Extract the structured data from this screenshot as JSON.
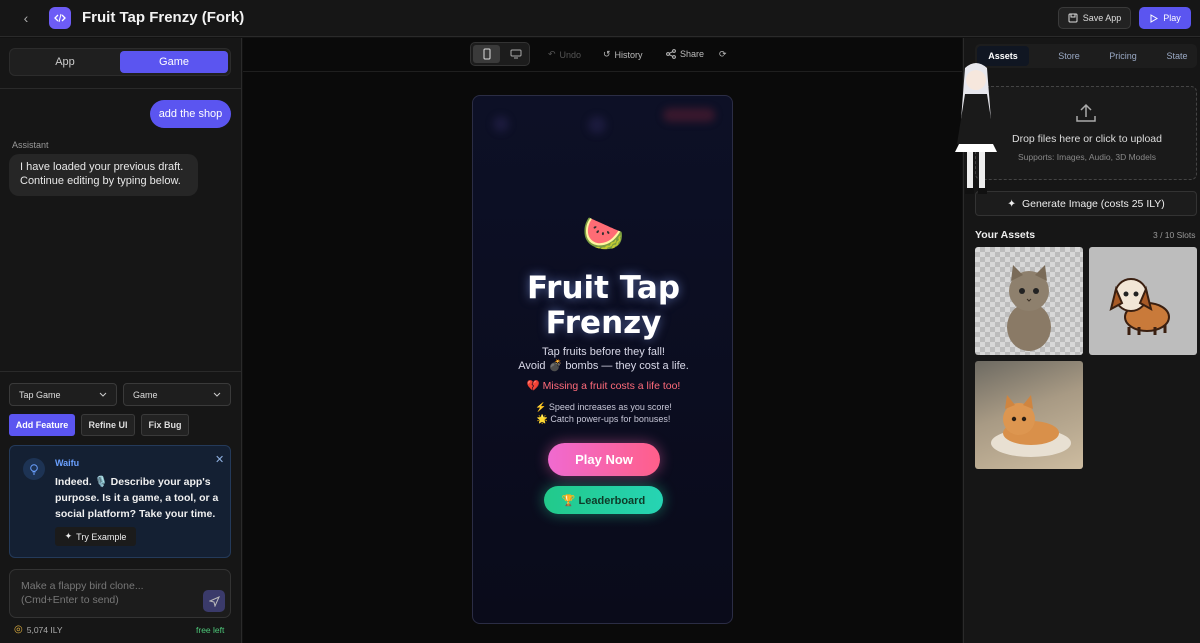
{
  "header": {
    "title": "Fruit Tap Frenzy (Fork)",
    "save_label": "Save App",
    "play_label": "Play"
  },
  "left_panel": {
    "segments": {
      "app": "App",
      "game": "Game"
    },
    "chat": {
      "user_message": "add the shop",
      "assistant_label": "Assistant",
      "assistant_line1": "I have loaded your previous draft.",
      "assistant_line2": "Continue editing by typing below."
    },
    "selects": {
      "template": "Tap Game",
      "mode": "Game"
    },
    "chips": {
      "add_feature": "Add Feature",
      "refine_ui": "Refine UI",
      "fix_bug": "Fix Bug"
    },
    "waifu": {
      "name": "Waifu",
      "message": "Indeed. 🎙️ Describe your app's purpose. Is it a game, a tool, or a social platform? Take your time.",
      "try_label": "Try Example"
    },
    "composer": {
      "placeholder": "Make a flappy bird clone... (Cmd+Enter to send)"
    },
    "footer": {
      "credits": "5,074 ILY",
      "free": "free left"
    }
  },
  "center_panel": {
    "toolbar": {
      "undo": "Undo",
      "history": "History",
      "share": "Share"
    },
    "game": {
      "emoji": "🍉",
      "title_line1": "Fruit Tap",
      "title_line2": "Frenzy",
      "desc_line1": "Tap fruits before they fall!",
      "desc_line2": "Avoid 💣 bombs — they cost a life.",
      "warning": "💔 Missing a fruit costs a life too!",
      "tip1": "⚡ Speed increases as you score!",
      "tip2": "🌟 Catch power-ups for bonuses!",
      "play_button": "Play Now",
      "leaderboard_button": "🏆 Leaderboard"
    }
  },
  "right_panel": {
    "tabs": {
      "assets": "Assets",
      "store": "Store",
      "pricing": "Pricing",
      "state": "State"
    },
    "dropzone": {
      "title": "Drop files here or click to upload",
      "subtitle": "Supports: Images, Audio, 3D Models"
    },
    "generate_label": "Generate Image (costs 25 ILY)",
    "assets_title": "Your Assets",
    "slots": "3 / 10 Slots"
  },
  "colors": {
    "accent": "#5b55f0",
    "panel": "#161616",
    "play_pink": "#f06ad0",
    "leader_green": "#22c98a"
  }
}
